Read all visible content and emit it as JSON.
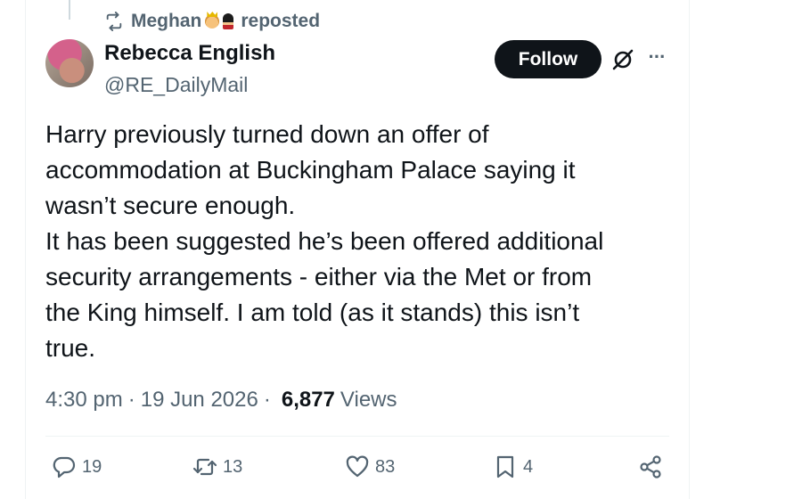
{
  "repost_banner": {
    "reposter": "Meghan",
    "label": "reposted"
  },
  "author": {
    "display_name": "Rebecca English",
    "handle": "@RE_DailyMail"
  },
  "header": {
    "follow_label": "Follow",
    "more_label": "···"
  },
  "tweet": {
    "text": "Harry previously turned down an offer of\naccommodation at Buckingham Palace saying it\nwasn’t secure enough.\nIt has been suggested he’s been offered additional\nsecurity arrangements - either via the Met or from\nthe King himself. I am told (as it stands) this isn’t\ntrue."
  },
  "meta": {
    "time": "4:30 pm",
    "separator": "·",
    "date": "19 Jun 2026",
    "views_count": "6,877",
    "views_label": "Views"
  },
  "actions": {
    "replies": "19",
    "reposts": "13",
    "likes": "83",
    "bookmarks": "4"
  },
  "colors": {
    "text": "#0f1419",
    "secondary": "#536471",
    "divider": "#eff3f4",
    "button_bg": "#0f1419"
  },
  "icons": [
    "repost-icon",
    "grok-icon",
    "more-icon",
    "reply-icon",
    "like-icon",
    "bookmark-icon",
    "share-icon"
  ]
}
